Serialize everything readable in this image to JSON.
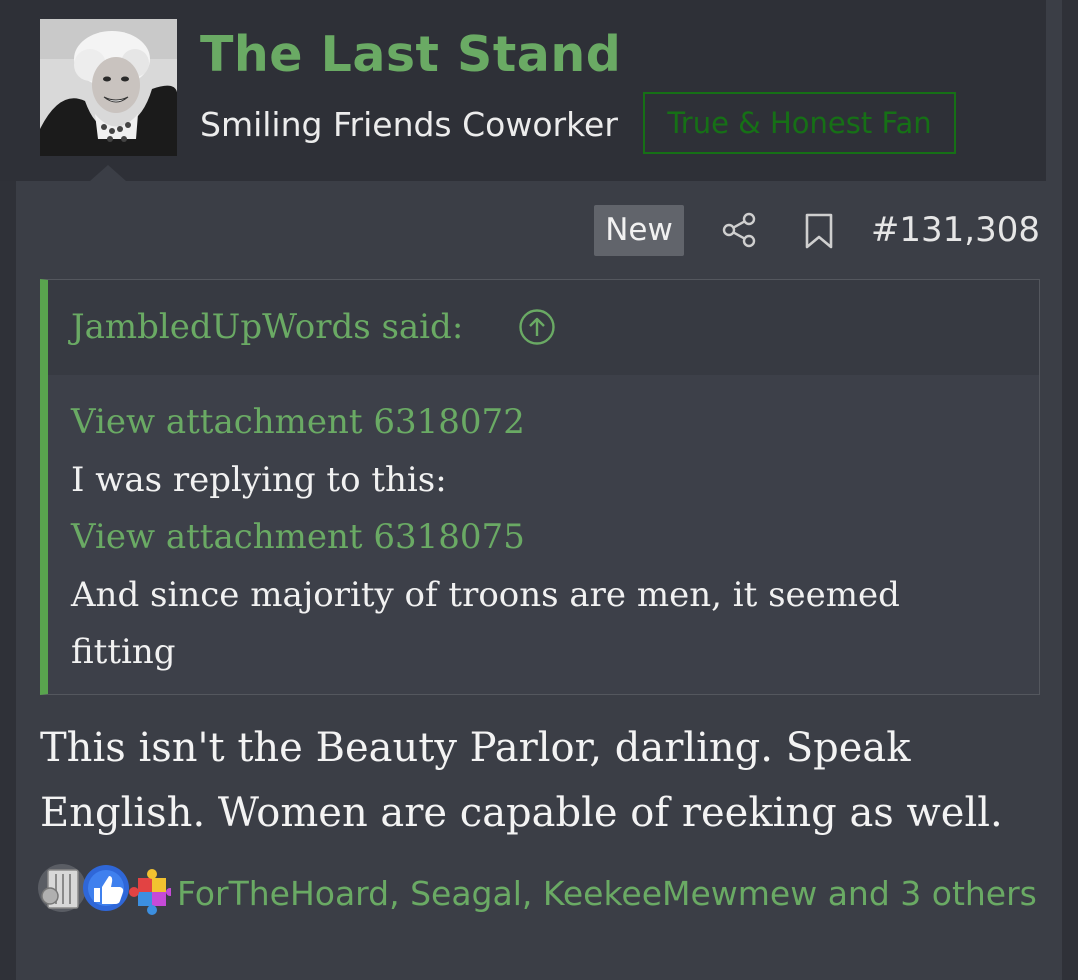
{
  "user": {
    "name": "The Last Stand",
    "title": "Smiling Friends Coworker",
    "badge": "True & Honest Fan"
  },
  "post": {
    "new_label": "New",
    "number": "#131,308",
    "body": "This isn't the Beauty Parlor, darling. Speak English. Women are capable of reeking as well."
  },
  "quote": {
    "author": "JambledUpWords said:",
    "lines": [
      {
        "type": "attachment",
        "text": "View attachment 6318072"
      },
      {
        "type": "text",
        "text": "I was replying to this:"
      },
      {
        "type": "attachment",
        "text": "View attachment 6318075"
      },
      {
        "type": "text",
        "text": "And since majority of troons are men, it seemed fitting"
      }
    ]
  },
  "reactions": {
    "icons": [
      "trash-can-icon",
      "thumbs-up-icon",
      "puzzle-icon"
    ],
    "text": "ForTheHoard, Seagal, KeekeeMewmew and 3 others"
  },
  "colors": {
    "background": "#3b3e46",
    "header": "#2e3037",
    "accent_green": "#6aaa64",
    "badge_green": "#167016",
    "quote_bar": "#59a44e"
  }
}
